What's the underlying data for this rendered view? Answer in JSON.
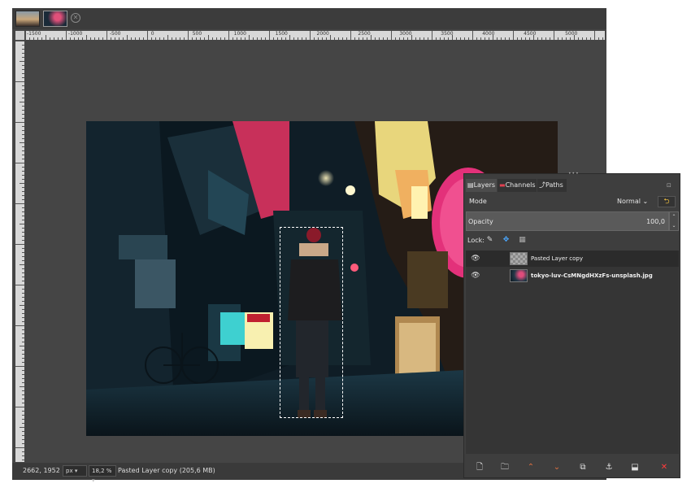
{
  "image_tabs": [
    {
      "name": "street photo thumbnail"
    },
    {
      "name": "tokyo image thumbnail"
    }
  ],
  "ruler": {
    "labels": [
      "-1500",
      "-1000",
      "-500",
      "0",
      "500",
      "1000",
      "1500",
      "2000",
      "2500",
      "3000",
      "3500",
      "4000",
      "4500",
      "5000"
    ]
  },
  "status": {
    "coords": "2662, 1952",
    "unit": "px",
    "zoom": "18,2 %",
    "message": "Pasted Layer copy (205,6 MB)"
  },
  "dock": {
    "tabs": {
      "layers": "Layers",
      "channels": "Channels",
      "paths": "Paths"
    },
    "mode_label": "Mode",
    "mode_value": "Normal",
    "opacity_label": "Opacity",
    "opacity_value": "100,0",
    "lock_label": "Lock:"
  },
  "layers": [
    {
      "name": "Pasted Layer copy",
      "visible": true,
      "selected": true
    },
    {
      "name": "tokyo-luv-CsMNgdHXzFs-unsplash.jpg",
      "visible": true,
      "selected": false
    }
  ],
  "colors": {
    "canvas_bg": "#454545",
    "panel_bg": "#3e3e3e",
    "accent_red": "#ff3b3b",
    "accent_orange": "#e07040"
  },
  "icons": {
    "layers_tab": "layers-icon",
    "channels_tab": "channels-icon",
    "paths_tab": "paths-icon",
    "eye": "eye-icon",
    "new_layer": "new-layer-icon",
    "new_group": "new-group-icon",
    "raise": "raise-layer-icon",
    "lower": "lower-layer-icon",
    "duplicate": "duplicate-icon",
    "anchor": "anchor-icon",
    "merge": "merge-down-icon",
    "delete": "delete-icon"
  }
}
